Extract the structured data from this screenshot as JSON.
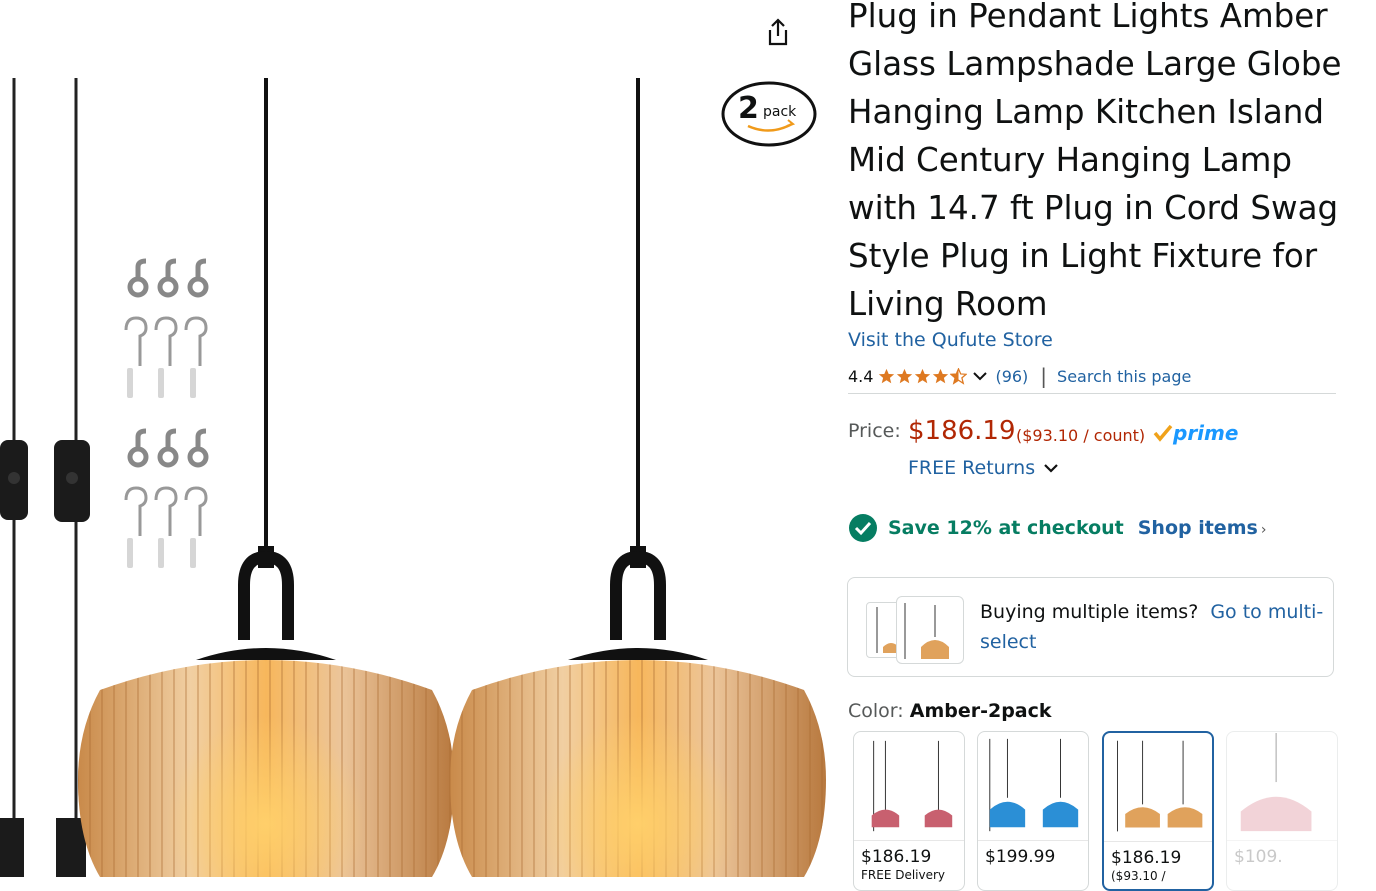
{
  "product": {
    "title": "Plug in Pendant Lights Amber Glass Lampshade Large Globe Hanging Lamp Kitchen Island Mid Century Hanging Lamp with 14.7 ft Plug in Cord Swag Style Plug in Light Fixture for Living Room",
    "store_link": "Visit the Qufute Store",
    "pack_badge_number": "2",
    "pack_badge_word": "pack"
  },
  "rating": {
    "value": "4.4",
    "stars": 4.4,
    "count": "(96)",
    "search_link": "Search this page"
  },
  "price": {
    "label": "Price:",
    "value": "$186.19",
    "unit": "($93.10 / count)",
    "prime_label": "prime",
    "free_returns": "FREE Returns"
  },
  "savings": {
    "text": "Save 12% at checkout",
    "shop_link": "Shop items"
  },
  "multi_select": {
    "text": "Buying multiple items?",
    "link": "Go to multi-select"
  },
  "color": {
    "label": "Color:",
    "selected": "Amber-2pack",
    "options": [
      {
        "price": "$186.19",
        "sub": "FREE Delivery",
        "shade": "pink"
      },
      {
        "price": "$199.99",
        "sub": "",
        "shade": "blue"
      },
      {
        "price": "$186.19",
        "sub": "($93.10 /",
        "shade": "amber"
      },
      {
        "price": "$109.",
        "sub": "",
        "shade": "pink-light"
      }
    ]
  },
  "colors": {
    "link": "#2162a1",
    "price": "#b12704",
    "save": "#067d62",
    "star": "#de7921",
    "prime": "#1a98ff",
    "amber_glass": "#e0a25c"
  }
}
